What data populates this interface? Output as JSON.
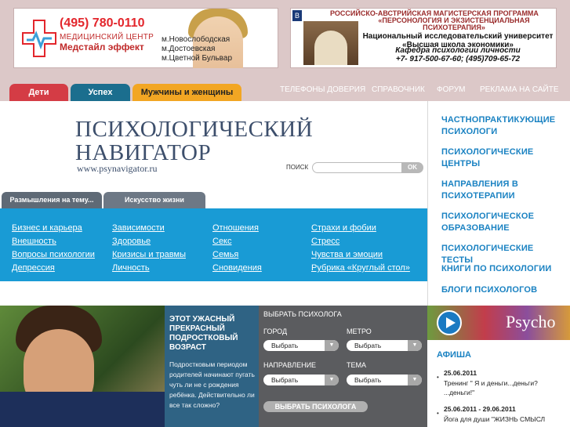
{
  "ads": {
    "left": {
      "phone": "(495) 780-0110",
      "subtitle": "МЕДИЦИНСКИЙ ЦЕНТР",
      "name": "Медстайл эффект",
      "metro": [
        "м.Новослободская",
        "м.Достоевская",
        "м.Цветной Бульвар"
      ]
    },
    "right": {
      "line1": "РОССИЙСКО-АВСТРИЙСКАЯ МАГИСТЕРСКАЯ ПРОГРАММА",
      "line2": "«ПЕРСОНОЛОГИЯ И ЭКЗИСТЕНЦИАЛЬНАЯ",
      "line3": "ПСИХОТЕРАПИЯ»",
      "line4": "Национальный исследовательский университет",
      "line5": "«Высшая школа экономики»",
      "line6": "Кафедра психологии личности",
      "line7": "+7- 917-500-67-60; (495)709-65-72"
    }
  },
  "tabs": [
    "Дети",
    "Успех",
    "Мужчины и женщины"
  ],
  "top_links": [
    "ТЕЛЕФОНЫ ДОВЕРИЯ",
    "СПРАВОЧНИК",
    "ФОРУМ",
    "РЕКЛАМА НА САЙТЕ"
  ],
  "logo": {
    "line1": "ПСИХОЛОГИЧЕСКИЙ",
    "line2": "НАВИГАТОР",
    "url": "www.psynavigator.ru"
  },
  "search": {
    "label": "ПОИСК",
    "placeholder": "",
    "button": "OK"
  },
  "subtabs": [
    "Размышления на тему...",
    "Искусство жизни"
  ],
  "categories": [
    [
      "Бизнес и карьера",
      "Внешность",
      "Вопросы психологии",
      "Депрессия"
    ],
    [
      "Зависимости",
      "Здоровье",
      "Кризисы и травмы",
      "Личность"
    ],
    [
      "Отношения",
      "Секс",
      "Семья",
      "Сновидения"
    ],
    [
      "Страхи и фобии",
      "Стресс",
      "Чувства и эмоции",
      "Рубрика «Круглый стол»"
    ]
  ],
  "sidebar": [
    "ЧАСТНОПРАКТИКУЮЩИЕ ПСИХОЛОГИ",
    "ПСИХОЛОГИЧЕСКИЕ ЦЕНТРЫ",
    "НАПРАВЛЕНИЯ В ПСИХОТЕРАПИИ",
    "ПСИХОЛОГИЧЕСКОЕ ОБРАЗОВАНИЕ",
    "ПСИХОЛОГИЧЕСКИЕ ТЕСТЫ",
    "КНИГИ ПО ПСИХОЛОГИИ",
    "БЛОГИ ПСИХОЛОГОВ"
  ],
  "teaser": {
    "title": "ЭТОТ УЖАСНЫЙ ПРЕКРАСНЫЙ ПОДРОСТКОВЫЙ ВОЗРАСТ",
    "text": "Подростковым периодом родителей начинают пугать чуть ли не с рождения ребёнка. Действительно ли все так сложно?"
  },
  "picker": {
    "title": "ВЫБРАТЬ ПСИХОЛОГА",
    "city": "ГОРОД",
    "metro": "МЕТРО",
    "direction": "НАПРАВЛЕНИЕ",
    "topic": "ТЕМА",
    "select": "Выбрать",
    "button": "ВЫБРАТЬ ПСИХОЛОГА"
  },
  "psycho_banner": "Psycho",
  "afisha": {
    "title": "АФИША",
    "events": [
      {
        "date": "25.06.2011",
        "text": "Тренинг \" Я и деньги...деньги? ...деньги!\""
      },
      {
        "date": "25.06.2011 - 29.06.2011",
        "text": "Йога для души \"ЖИЗНЬ СМЫСЛ"
      }
    ]
  }
}
